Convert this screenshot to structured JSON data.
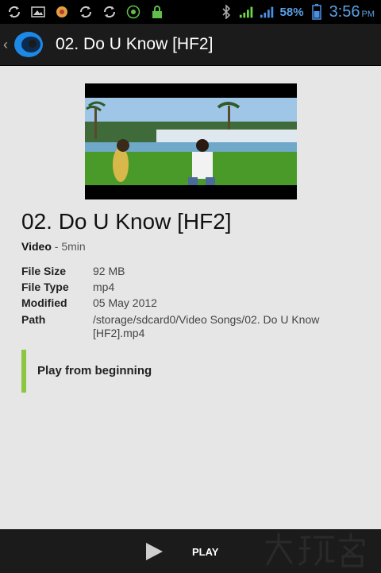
{
  "status_bar": {
    "battery_percent": "58%",
    "time": "3:56",
    "ampm": "PM",
    "icons": [
      "sync-icon",
      "image-icon",
      "app-icon",
      "sync-icon",
      "sync-icon",
      "counter-icon",
      "lock-icon",
      "bluetooth-icon",
      "signal-icon",
      "signal-icon",
      "battery-icon"
    ]
  },
  "action_bar": {
    "title": "02. Do U Know [HF2]"
  },
  "video": {
    "title": "02. Do U Know [HF2]",
    "type": "Video",
    "separator": " - ",
    "duration": "5min"
  },
  "details": {
    "file_size_label": "File Size",
    "file_size": "92 MB",
    "file_type_label": "File Type",
    "file_type": "mp4",
    "modified_label": "Modified",
    "modified": "05 May 2012",
    "path_label": "Path",
    "path": "/storage/sdcard0/Video Songs/02. Do U Know [HF2].mp4"
  },
  "actions": {
    "play_from_beginning": "Play from beginning",
    "play": "PLAY"
  },
  "colors": {
    "accent_green": "#8dc63f",
    "status_blue": "#5aa0e6",
    "bar_dark": "#1b1b1b"
  },
  "watermark": "大玩客"
}
